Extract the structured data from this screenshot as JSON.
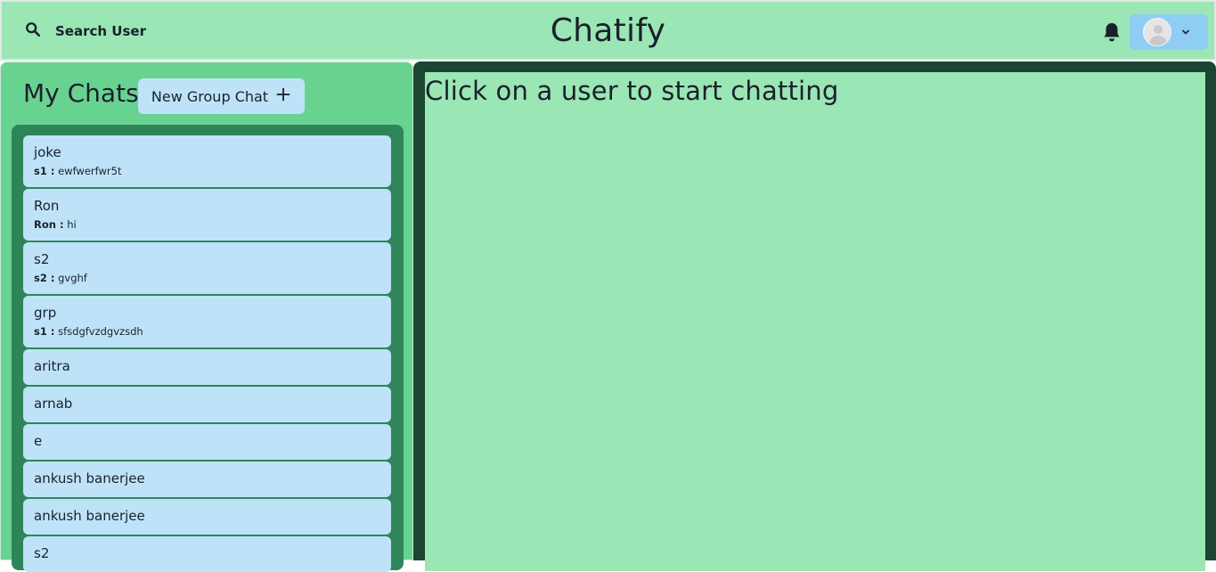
{
  "header": {
    "search_label": "Search User",
    "app_title": "Chatify",
    "icons": {
      "search": "search-icon",
      "notification": "bell-icon",
      "avatar": "user-avatar-icon",
      "menu": "chevron-down-icon"
    },
    "colors": {
      "bar": "#9ae6b4",
      "profile_button": "#90cdf4"
    }
  },
  "sidebar": {
    "title": "My Chats",
    "new_group_label": "New Group Chat",
    "chats": [
      {
        "name": "joke",
        "sender": "s1 :",
        "message": "ewfwerfwr5t"
      },
      {
        "name": "Ron",
        "sender": "Ron :",
        "message": "hi"
      },
      {
        "name": "s2",
        "sender": "s2 :",
        "message": "gvghf"
      },
      {
        "name": "grp",
        "sender": "s1 :",
        "message": "sfsdgfvzdgvzsdh"
      },
      {
        "name": "aritra"
      },
      {
        "name": "arnab"
      },
      {
        "name": "e"
      },
      {
        "name": "ankush banerjee"
      },
      {
        "name": "ankush banerjee"
      },
      {
        "name": "s2"
      }
    ],
    "colors": {
      "panel": "#68d391",
      "list_bg": "#2f855a",
      "item_bg": "#bee3f8"
    }
  },
  "main": {
    "placeholder": "Click on a user to start chatting",
    "colors": {
      "frame": "#1c4532",
      "area": "#9ae6b4"
    }
  }
}
